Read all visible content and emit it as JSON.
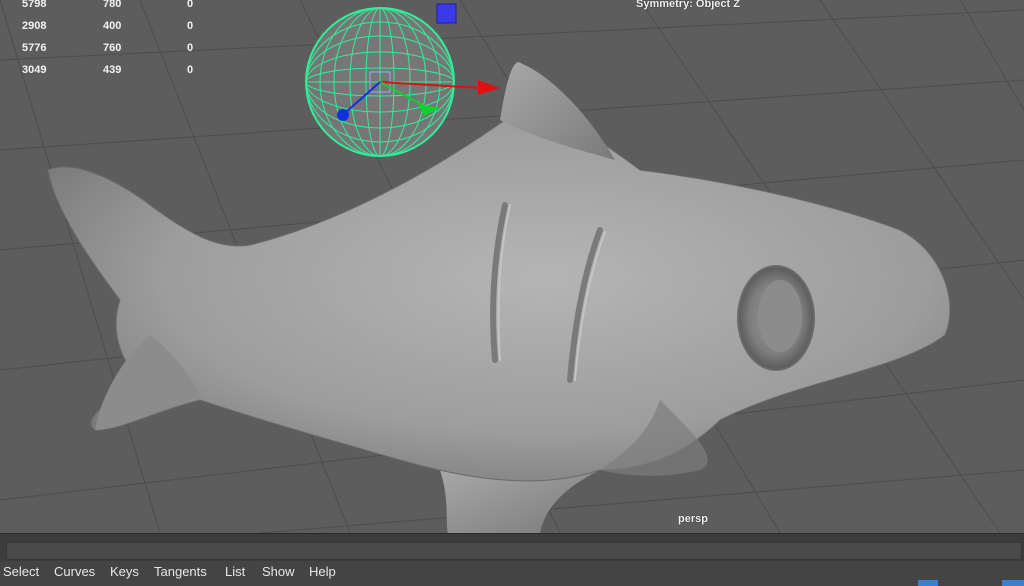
{
  "hud": {
    "stats": [
      {
        "a": "5798",
        "b": "780",
        "c": "0"
      },
      {
        "a": "2908",
        "b": "400",
        "c": "0"
      },
      {
        "a": "5776",
        "b": "760",
        "c": "0"
      },
      {
        "a": "3049",
        "b": "439",
        "c": "0"
      }
    ],
    "symmetry": "Symmetry: Object Z",
    "camera": "persp"
  },
  "menu": {
    "items": [
      "Select",
      "Curves",
      "Keys",
      "Tangents",
      "List",
      "Show",
      "Help"
    ]
  },
  "colors": {
    "viewport_bg": "#5d5d5d",
    "grid_line": "#4b4b4b",
    "model_gray": "#9a9a9a",
    "manip_sphere": "#2ef09a",
    "axis_x": "#e01010",
    "axis_y": "#10d030",
    "axis_z": "#1030e0",
    "menubar_bg": "#444444"
  }
}
